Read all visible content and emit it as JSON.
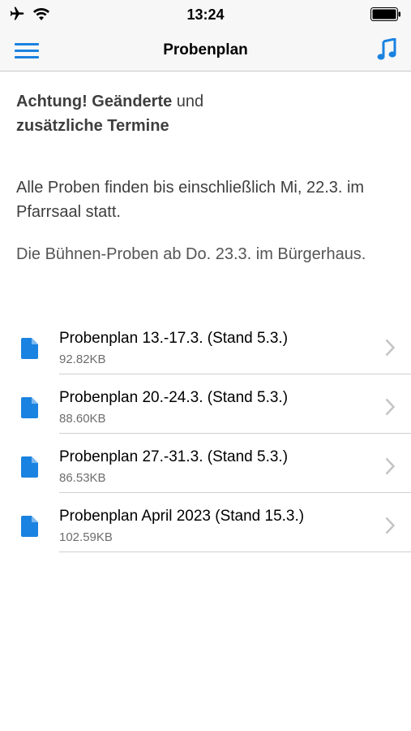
{
  "status_bar": {
    "time": "13:24"
  },
  "nav": {
    "title": "Probenplan",
    "menu_icon": "hamburger-menu-icon",
    "music_icon": "music-note-icon"
  },
  "notice": {
    "headline_bold_1": "Achtung! Geänderte",
    "headline_normal": " und",
    "headline_bold_2": "zusätzliche Termine",
    "paragraph_1": "Alle Proben finden bis einschließlich Mi, 22.3. im Pfarrsaal statt.",
    "paragraph_2": "Die Bühnen-Proben ab Do. 23.3. im Bürgerhaus."
  },
  "files": [
    {
      "name": "Probenplan 13.-17.3. (Stand 5.3.)",
      "size": "92.82KB"
    },
    {
      "name": "Probenplan 20.-24.3. (Stand 5.3.)",
      "size": "88.60KB"
    },
    {
      "name": "Probenplan 27.-31.3. (Stand 5.3.)",
      "size": "86.53KB"
    },
    {
      "name": "Probenplan April 2023 (Stand 15.3.)",
      "size": "102.59KB"
    }
  ],
  "colors": {
    "accent": "#1a82e0",
    "bar_bg": "#f7f7f7"
  }
}
